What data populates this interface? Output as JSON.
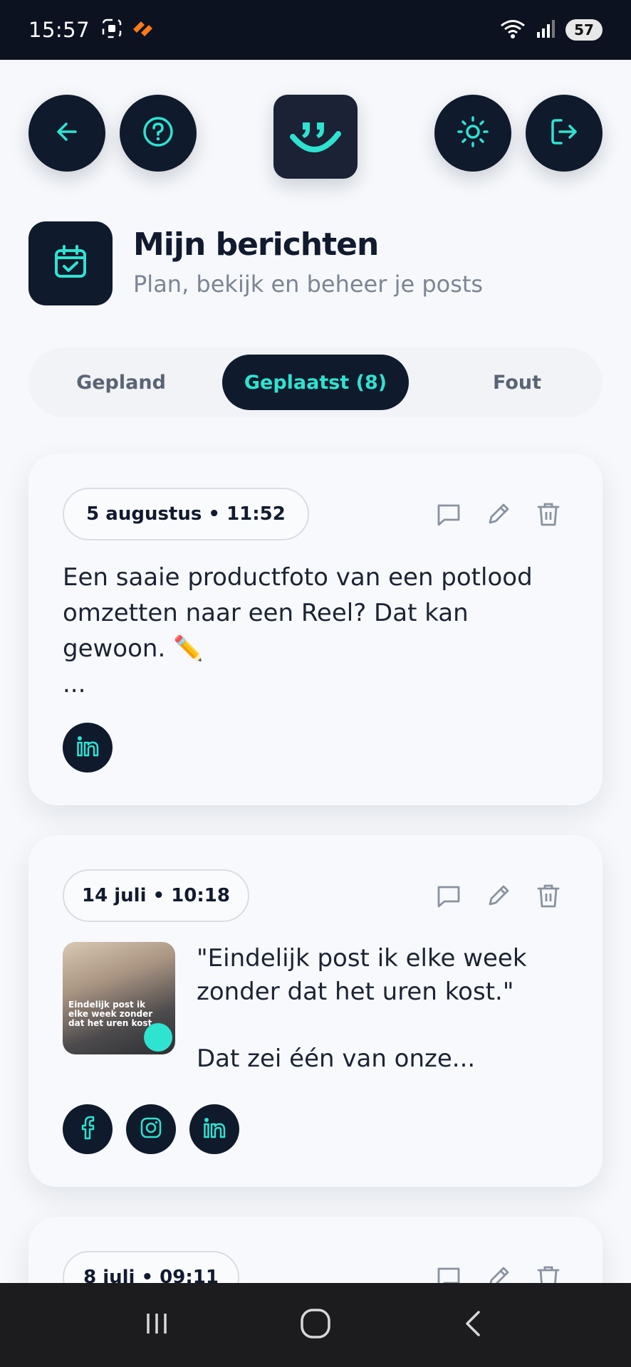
{
  "status_bar": {
    "time": "15:57",
    "battery": "57"
  },
  "header": {
    "back_icon": "arrow-left-icon",
    "help_icon": "question-icon",
    "logo_icon": "smile-quote-logo",
    "theme_icon": "sun-icon",
    "logout_icon": "logout-icon"
  },
  "page": {
    "title": "Mijn berichten",
    "subtitle": "Plan, bekijk en beheer je posts",
    "icon": "calendar-check-icon"
  },
  "tabs": [
    {
      "label": "Gepland",
      "active": false
    },
    {
      "label": "Geplaatst (8)",
      "active": true
    },
    {
      "label": "Fout",
      "active": false
    }
  ],
  "posts": [
    {
      "date": "5 augustus • 11:52",
      "text": "Een saaie productfoto van een potlood omzetten naar een Reel? Dat kan gewoon. ✏️\n...",
      "platforms": [
        "linkedin-icon"
      ]
    },
    {
      "date": "14 juli • 10:18",
      "text": "\"Eindelijk post ik elke week zonder dat het uren kost.\"\n\nDat zei één van onze...",
      "thumbnail_caption": "Eindelijk post ik elke week zonder dat het uren kost.",
      "platforms": [
        "facebook-icon",
        "instagram-icon",
        "linkedin-icon"
      ]
    },
    {
      "date": "8 juli • 09:11",
      "platforms": []
    }
  ],
  "colors": {
    "navy": "#0f1a2c",
    "accent": "#2ee3d0",
    "background": "#f6f8fb",
    "muted": "#7c8594"
  }
}
